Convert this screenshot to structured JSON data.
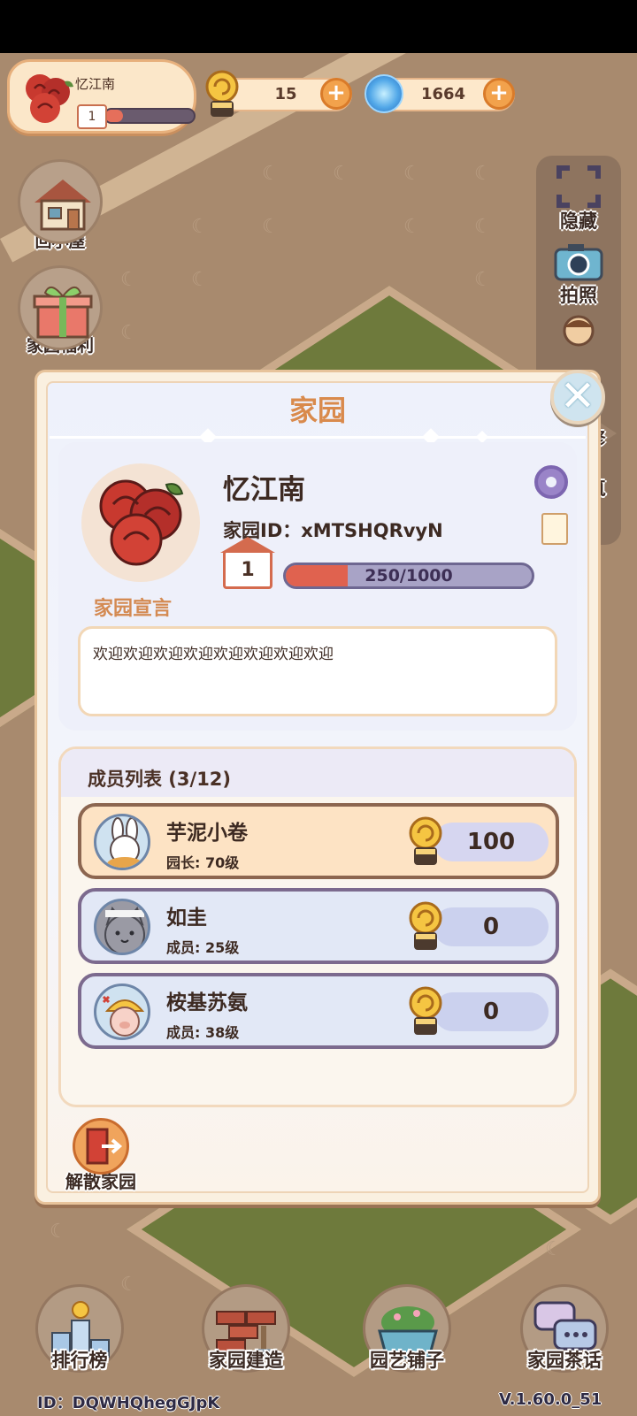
{
  "player": {
    "name": "忆江南",
    "level": "1",
    "exp_fraction": 0.2
  },
  "currencies": {
    "snail": "15",
    "orb": "1664"
  },
  "left_menu": [
    {
      "label": "回小屋",
      "icon": "house-icon"
    },
    {
      "label": "家园福利",
      "icon": "gift-icon"
    }
  ],
  "right_menu": [
    {
      "label": "隐藏",
      "icon": "hide-icon"
    },
    {
      "label": "拍照",
      "icon": "camera-icon"
    },
    {
      "label": "修",
      "icon": "repair-icon"
    },
    {
      "label": "筑",
      "icon": "build-icon"
    }
  ],
  "modal": {
    "title": "家园",
    "garden_name": "忆江南",
    "garden_id": "家园ID：xMTSHQRvyN",
    "level": "1",
    "exp_text": "250/1000",
    "exp_fraction": 0.25,
    "declaration_label": "家园宣言",
    "declaration_text": "欢迎欢迎欢迎欢迎欢迎欢迎欢迎欢迎",
    "member_title": "成员列表 (3/12)",
    "members": [
      {
        "name": "芋泥小卷",
        "role": "园长: 70级",
        "value": "100"
      },
      {
        "name": "如圭",
        "role": "成员: 25级",
        "value": "0"
      },
      {
        "name": "桉基苏氨",
        "role": "成员: 38级",
        "value": "0"
      }
    ],
    "dissolve_label": "解散家园"
  },
  "bottom_nav": [
    {
      "label": "排行榜"
    },
    {
      "label": "家园建造"
    },
    {
      "label": "园艺铺子"
    },
    {
      "label": "家园茶话"
    }
  ],
  "footer": {
    "id": "ID：DQWHQhegGJpK",
    "version": "V.1.60.0_51"
  },
  "colors": {
    "accent": "#d98a4c",
    "exp_fill": "#e0624f",
    "background": "#a88a6e"
  }
}
